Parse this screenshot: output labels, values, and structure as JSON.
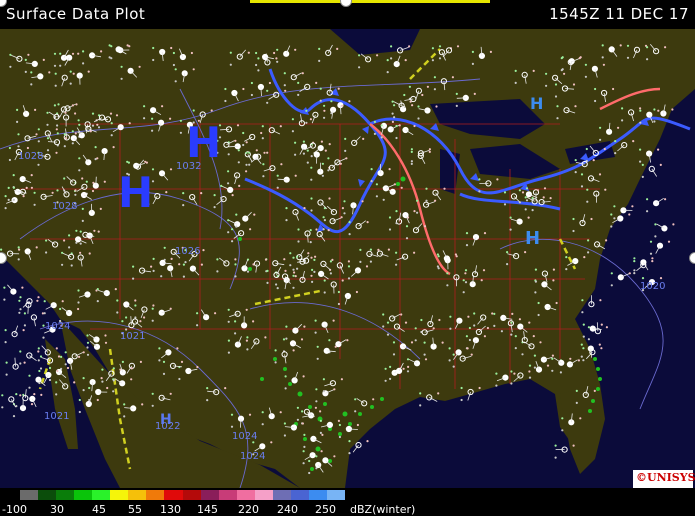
{
  "title": "Surface Data Plot",
  "timestamp": "1545Z 11 DEC 17",
  "legend": {
    "units": "dBZ(winter)",
    "ticks": [
      "-100",
      "30",
      "45",
      "55",
      "130",
      "145",
      "220",
      "240",
      "250"
    ],
    "colors": [
      "#6b6b6b",
      "#0b4d0b",
      "#0a7d0a",
      "#0ac40a",
      "#2af22a",
      "#f5f50a",
      "#f5c00a",
      "#f07a0a",
      "#e00a0a",
      "#b40a0a",
      "#8a1e5a",
      "#c83c78",
      "#f06ea0",
      "#f5a0c8",
      "#6e6eb4",
      "#4a64d2",
      "#3c8cf0",
      "#78b4f5"
    ]
  },
  "pressure_centers": [
    {
      "label": "H",
      "kind": "high-major"
    },
    {
      "label": "H",
      "kind": "high-major"
    },
    {
      "label": "H",
      "kind": "high-minor"
    },
    {
      "label": "H",
      "kind": "high-minor"
    },
    {
      "label": "H",
      "kind": "high-minor"
    }
  ],
  "isobar_labels": [
    "1028",
    "1024",
    "1021",
    "1021",
    "1022",
    "1024",
    "1020",
    "1024",
    "1026",
    "1028",
    "1032"
  ],
  "logo": "©UNISYS",
  "colors": {
    "land": "#3d3a0e",
    "water": "#0b0b3a",
    "cold_front": "#3b5bff",
    "warm_front": "#ff6b6b",
    "borders": "#b01e1e",
    "isobars": "#6a6ad0",
    "trough": "#d0d020"
  }
}
